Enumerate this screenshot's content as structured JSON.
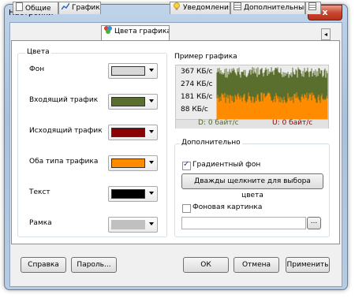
{
  "window": {
    "title": "Настройки",
    "close_label": "x"
  },
  "tabs": [
    {
      "label": "Общие",
      "icon": "general-icon"
    },
    {
      "label": "График",
      "icon": "graph-icon"
    },
    {
      "label": "Цвета графика",
      "icon": "palette-icon",
      "active": true
    },
    {
      "label": "Уведомления",
      "icon": "bulb-icon"
    },
    {
      "label": "Дополнительные",
      "icon": "list-icon"
    }
  ],
  "colors_group": {
    "title": "Цвета",
    "items": [
      {
        "label": "Фон",
        "color": "#d8d8d8"
      },
      {
        "label": "Входящий трафик",
        "color": "#5a6e2e"
      },
      {
        "label": "Исходящий трафик",
        "color": "#8b0000"
      },
      {
        "label": "Оба типа трафика",
        "color": "#ff8c00"
      },
      {
        "label": "Текст",
        "color": "#000000"
      },
      {
        "label": "Рамка",
        "color": "#c0c0c0"
      }
    ]
  },
  "preview": {
    "title": "Пример графика",
    "y_labels": [
      "367 КБ/с",
      "274 КБ/с",
      "181 КБ/с",
      "88 КБ/с"
    ],
    "download": "D: 0 байт/с",
    "upload": "U: 0 байт/с"
  },
  "extra_group": {
    "title": "Дополнительно",
    "gradient_label": "Градиентный фон",
    "gradient_checked": true,
    "pick_color_button": "Дважды щелкните для выбора цвета",
    "bg_image_label": "Фоновая картинка",
    "bg_image_checked": false,
    "bg_image_path": "",
    "browse_label": "..."
  },
  "buttons": {
    "help": "Справка",
    "password": "Пароль...",
    "ok": "ОК",
    "cancel": "Отмена",
    "apply": "Применить"
  }
}
